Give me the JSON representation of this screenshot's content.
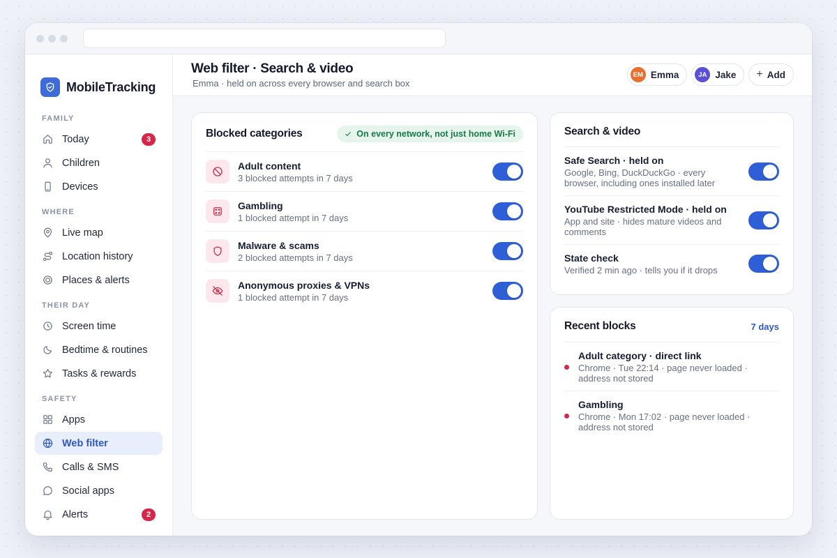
{
  "brand": {
    "name": "MobileTracking"
  },
  "sidebar": {
    "sections": [
      {
        "label": "FAMILY",
        "items": [
          {
            "label": "Today",
            "icon": "home-icon",
            "badge": "3"
          },
          {
            "label": "Children",
            "icon": "user-icon"
          },
          {
            "label": "Devices",
            "icon": "phone-icon"
          }
        ]
      },
      {
        "label": "WHERE",
        "items": [
          {
            "label": "Live map",
            "icon": "map-pin-icon"
          },
          {
            "label": "Location history",
            "icon": "route-icon"
          },
          {
            "label": "Places & alerts",
            "icon": "target-icon"
          }
        ]
      },
      {
        "label": "THEIR DAY",
        "items": [
          {
            "label": "Screen time",
            "icon": "clock-icon"
          },
          {
            "label": "Bedtime & routines",
            "icon": "moon-icon"
          },
          {
            "label": "Tasks & rewards",
            "icon": "star-icon"
          }
        ]
      },
      {
        "label": "SAFETY",
        "items": [
          {
            "label": "Apps",
            "icon": "grid-icon"
          },
          {
            "label": "Web filter",
            "icon": "globe-icon",
            "active": true
          },
          {
            "label": "Calls & SMS",
            "icon": "phone-call-icon"
          },
          {
            "label": "Social apps",
            "icon": "chat-icon"
          },
          {
            "label": "Alerts",
            "icon": "bell-icon",
            "badge": "2"
          }
        ]
      }
    ]
  },
  "header": {
    "title": "Web filter · Search & video",
    "subtitle": "Emma · held on across every browser and search box",
    "people": [
      {
        "initials": "EM",
        "name": "Emma",
        "color": "#e8702f"
      },
      {
        "initials": "JA",
        "name": "Jake",
        "color": "#5b4fd6"
      }
    ],
    "add_label": "Add"
  },
  "blocked": {
    "title": "Blocked categories",
    "pill": "On every network, not just home Wi-Fi",
    "rows": [
      {
        "title": "Adult content",
        "sub": "3 blocked attempts in 7 days",
        "icon": "block-icon",
        "on": true
      },
      {
        "title": "Gambling",
        "sub": "1 blocked attempt in 7 days",
        "icon": "dice-icon",
        "on": true
      },
      {
        "title": "Malware & scams",
        "sub": "2 blocked attempts in 7 days",
        "icon": "shield-icon",
        "on": true
      },
      {
        "title": "Anonymous proxies & VPNs",
        "sub": "1 blocked attempt in 7 days",
        "icon": "eye-off-icon",
        "on": true
      }
    ]
  },
  "search_video": {
    "title": "Search & video",
    "rows": [
      {
        "title": "Safe Search · held on",
        "sub": "Google, Bing, DuckDuckGo · every browser, including ones installed later",
        "on": true
      },
      {
        "title": "YouTube Restricted Mode · held on",
        "sub": "App and site · hides mature videos and comments",
        "on": true
      },
      {
        "title": "State check",
        "sub": "Verified 2 min ago · tells you if it drops",
        "on": true
      }
    ]
  },
  "recent": {
    "title": "Recent blocks",
    "range": "7 days",
    "rows": [
      {
        "title": "Adult category · direct link",
        "sub": "Chrome · Tue 22:14 · page never loaded · address not stored"
      },
      {
        "title": "Gambling",
        "sub": "Chrome · Mon 17:02 · page never loaded · address not stored"
      }
    ]
  }
}
